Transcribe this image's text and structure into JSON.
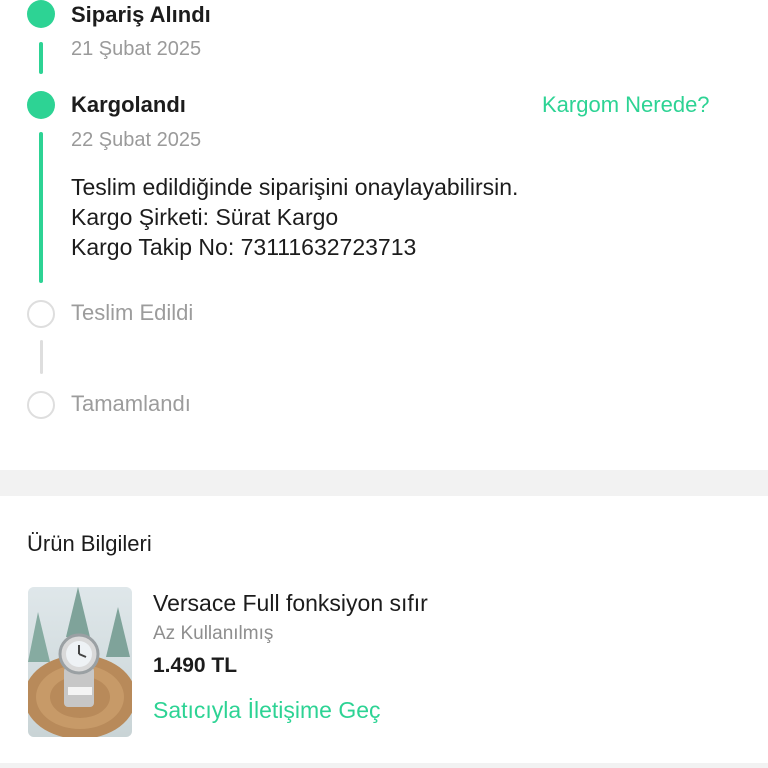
{
  "timeline": {
    "steps": [
      {
        "title": "Sipariş Alındı",
        "date": "21 Şubat 2025",
        "status": "done"
      },
      {
        "title": "Kargolandı",
        "date": "22 Şubat 2025",
        "status": "done",
        "action_label": "Kargom Nerede?",
        "details": [
          "Teslim edildiğinde siparişini onaylayabilirsin.",
          "Kargo Şirketi: Sürat Kargo",
          "Kargo Takip No: 73111632723713"
        ]
      },
      {
        "title": "Teslim Edildi",
        "status": "pending"
      },
      {
        "title": "Tamamlandı",
        "status": "pending"
      }
    ]
  },
  "product_section": {
    "title": "Ürün Bilgileri",
    "product": {
      "name": "Versace Full fonksiyon sıfır",
      "condition": "Az Kullanılmış",
      "price": "1.490 TL",
      "contact_label": "Satıcıyla İletişime Geç",
      "image_icon": "watch-photo"
    }
  },
  "colors": {
    "accent": "#2dd394",
    "muted": "#9a9a9a",
    "band": "#f2f2f2"
  }
}
